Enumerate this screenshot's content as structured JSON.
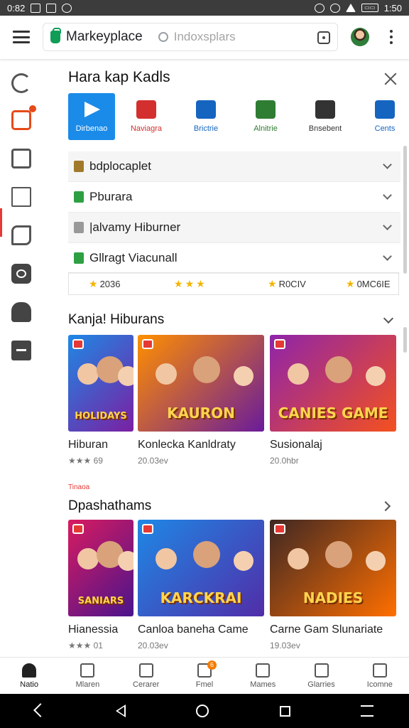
{
  "status_bar": {
    "time_left": "0:82",
    "time_right": "1:50",
    "battery": "▭▭"
  },
  "app_bar": {
    "brand": "Markeyplace",
    "search_placeholder": "Indoxsplars"
  },
  "panel": {
    "title": "Hara kap Kadls",
    "categories": [
      {
        "label": "Dirbenao",
        "color": "#1a8be8",
        "icon": "play-icon",
        "selected": true
      },
      {
        "label": "Naviagra",
        "color": "#d32f2f",
        "icon": "movie-icon",
        "selected": false
      },
      {
        "label": "Brictrie",
        "color": "#1565c0",
        "icon": "food-icon",
        "selected": false
      },
      {
        "label": "Alnitrie",
        "color": "#2e7d32",
        "icon": "check-icon",
        "selected": false
      },
      {
        "label": "Bnsebent",
        "color": "#333333",
        "icon": "mail-icon",
        "selected": false
      },
      {
        "label": "Cents",
        "color": "#1565c0",
        "icon": "music-icon",
        "selected": false
      }
    ],
    "rows": [
      {
        "label": "bdplocaplet",
        "icon_color": "#a07a2a"
      },
      {
        "label": "Pburara",
        "icon_color": "#2ea043"
      },
      {
        "label": "|alvamy Hiburner",
        "icon_color": "#999999"
      },
      {
        "label": "Gllragt Viacunall",
        "icon_color": "#2ea043"
      }
    ],
    "ratings": [
      {
        "value": "2036",
        "stars": 1
      },
      {
        "value": "",
        "stars": 3
      },
      {
        "value": "R0CIV",
        "stars": 1
      },
      {
        "value": "0MC6IE",
        "stars": 1
      }
    ]
  },
  "sections": [
    {
      "title": "Kanja! Hiburans",
      "cards": [
        {
          "title": "Hiburan",
          "meta": "★★★ 69",
          "art": "HOLIDAYS",
          "palette": [
            "#1e88e5",
            "#7b1fa2"
          ]
        },
        {
          "title": "Konlecka Kanldraty",
          "meta": "20.03ev",
          "art": "KAURON",
          "palette": [
            "#ff8f00",
            "#6a1b9a"
          ]
        },
        {
          "title": "Susionalaj",
          "meta": "20.0hbr",
          "art": "CANIES GAME",
          "palette": [
            "#8e24aa",
            "#f4511e"
          ]
        }
      ]
    },
    {
      "title": "Dpashathams",
      "tag": "Tinaoa",
      "cards": [
        {
          "title": "Hianessia",
          "meta": "★★★ 01",
          "art": "SANIARS",
          "palette": [
            "#d81b60",
            "#4a148c"
          ]
        },
        {
          "title": "Canloa baneha Came",
          "meta": "20.03ev",
          "art": "KARCKRAI",
          "palette": [
            "#1e88e5",
            "#512da8"
          ]
        },
        {
          "title": "Carne Gam Slunariate",
          "meta": "19.03ev",
          "art": "NADIES",
          "palette": [
            "#3e2723",
            "#ff6f00"
          ]
        }
      ]
    }
  ],
  "bottom_nav": [
    {
      "label": "Natio",
      "icon": "home-icon",
      "active": true
    },
    {
      "label": "Mlaren",
      "icon": "house-icon",
      "active": false
    },
    {
      "label": "Cerarer",
      "icon": "media-icon",
      "active": false
    },
    {
      "label": "Fmel",
      "icon": "notification-icon",
      "active": false,
      "badge": "6"
    },
    {
      "label": "Mames",
      "icon": "smile-icon",
      "active": false
    },
    {
      "label": "Glarries",
      "icon": "shop-icon",
      "active": false
    },
    {
      "label": "Icomne",
      "icon": "person-icon",
      "active": false
    }
  ]
}
